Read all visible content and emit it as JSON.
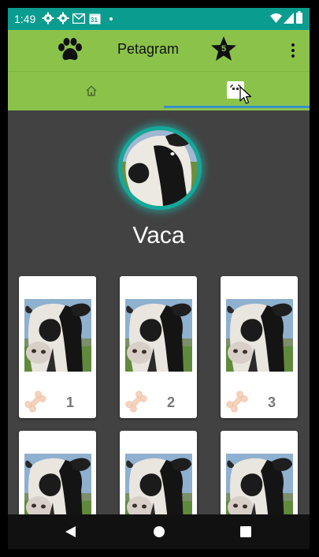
{
  "status_bar": {
    "time": "1:49",
    "icons": [
      "gear-icon",
      "gear-icon",
      "gmail-icon",
      "calendar-icon",
      "dot-icon",
      "wifi-icon",
      "signal-icon",
      "battery-icon"
    ],
    "calendar_day": "31",
    "background": "#0a9c8f"
  },
  "toolbar": {
    "title": "Petagram",
    "leading_icon": "paw-icon",
    "star_badge": "5",
    "overflow_icon": "more-vert-icon",
    "background": "#8bc34a"
  },
  "tabs": [
    {
      "icon": "home-icon",
      "selected": false
    },
    {
      "icon": "profile-tab-icon",
      "selected": true
    }
  ],
  "profile": {
    "name": "Vaca"
  },
  "grid": {
    "items": [
      {
        "likes": "1"
      },
      {
        "likes": "2"
      },
      {
        "likes": "3"
      },
      {
        "likes": ""
      },
      {
        "likes": ""
      },
      {
        "likes": ""
      }
    ]
  },
  "nav": {
    "icons": [
      "back-icon",
      "home-circle-icon",
      "recents-icon"
    ]
  },
  "colors": {
    "accent_ring": "#12a89a",
    "tab_indicator": "#3a8ec4",
    "bone": "#f6d3bd"
  }
}
